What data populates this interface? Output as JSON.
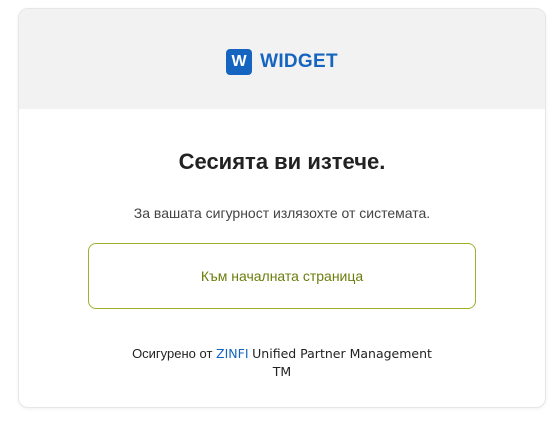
{
  "header": {
    "logo_mark": "W",
    "logo_text": "WIDGET"
  },
  "main": {
    "title": "Сесията ви изтече.",
    "subtitle": "За вашата сигурност излязохте от системата.",
    "home_button_label": "Към началната страница"
  },
  "footer": {
    "prefix": "Осигурено от",
    "brand": "ZINFI",
    "suffix": "Unified Partner Management",
    "trademark": "TM"
  },
  "colors": {
    "brand_blue": "#1565c0",
    "button_border": "#a0b02a",
    "button_text": "#6b7d0b",
    "header_bg": "#f2f2f2"
  }
}
